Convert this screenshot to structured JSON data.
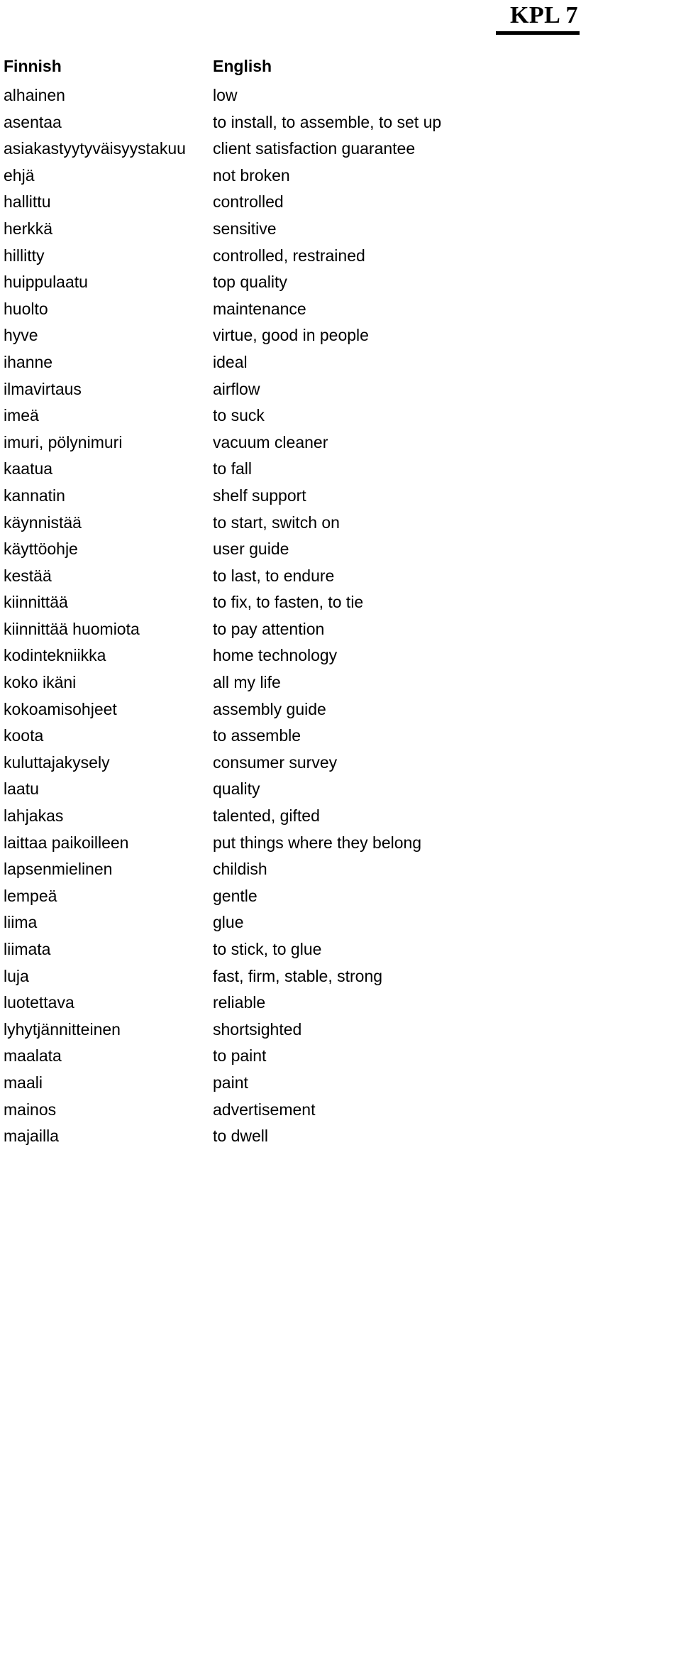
{
  "document": {
    "title": "KPL 7",
    "title_style": "bold-underlined-serif"
  },
  "table": {
    "headers": {
      "finnish": "Finnish",
      "english": "English"
    },
    "rows": [
      {
        "finnish": "alhainen",
        "english": "low"
      },
      {
        "finnish": "asentaa",
        "english": "to install, to assemble, to set up"
      },
      {
        "finnish": "asiakastyytyväisyystakuu",
        "english": "client satisfaction guarantee"
      },
      {
        "finnish": "ehjä",
        "english": "not broken"
      },
      {
        "finnish": "hallittu",
        "english": "controlled"
      },
      {
        "finnish": "herkkä",
        "english": "sensitive"
      },
      {
        "finnish": "hillitty",
        "english": "controlled, restrained"
      },
      {
        "finnish": "huippulaatu",
        "english": "top quality"
      },
      {
        "finnish": "huolto",
        "english": "maintenance"
      },
      {
        "finnish": "hyve",
        "english": "virtue, good in people"
      },
      {
        "finnish": "ihanne",
        "english": "ideal"
      },
      {
        "finnish": "ilmavirtaus",
        "english": "airflow"
      },
      {
        "finnish": "imeä",
        "english": "to suck"
      },
      {
        "finnish": "imuri, pölynimuri",
        "english": "vacuum cleaner"
      },
      {
        "finnish": "kaatua",
        "english": "to fall"
      },
      {
        "finnish": "kannatin",
        "english": "shelf support"
      },
      {
        "finnish": "käynnistää",
        "english": "to start, switch on"
      },
      {
        "finnish": "käyttöohje",
        "english": "user guide"
      },
      {
        "finnish": "kestää",
        "english": "to last, to endure"
      },
      {
        "finnish": "kiinnittää",
        "english": "to fix, to fasten, to tie"
      },
      {
        "finnish": "kiinnittää huomiota",
        "english": "to pay attention"
      },
      {
        "finnish": "kodintekniikka",
        "english": "home technology"
      },
      {
        "finnish": "koko ikäni",
        "english": "all my life"
      },
      {
        "finnish": "kokoamisohjeet",
        "english": "assembly guide"
      },
      {
        "finnish": "koota",
        "english": "to assemble"
      },
      {
        "finnish": "kuluttajakysely",
        "english": "consumer survey"
      },
      {
        "finnish": "laatu",
        "english": "quality"
      },
      {
        "finnish": "lahjakas",
        "english": "talented, gifted"
      },
      {
        "finnish": "laittaa paikoilleen",
        "english": "put things where they belong"
      },
      {
        "finnish": "lapsenmielinen",
        "english": "childish"
      },
      {
        "finnish": "lempeä",
        "english": "gentle"
      },
      {
        "finnish": "liima",
        "english": "glue"
      },
      {
        "finnish": "liimata",
        "english": "to stick, to glue"
      },
      {
        "finnish": "luja",
        "english": "fast, firm, stable, strong"
      },
      {
        "finnish": "luotettava",
        "english": "reliable"
      },
      {
        "finnish": "lyhytjännitteinen",
        "english": "shortsighted"
      },
      {
        "finnish": "maalata",
        "english": "to paint"
      },
      {
        "finnish": "maali",
        "english": "paint"
      },
      {
        "finnish": "mainos",
        "english": "advertisement"
      },
      {
        "finnish": "majailla",
        "english": "to dwell"
      }
    ]
  }
}
